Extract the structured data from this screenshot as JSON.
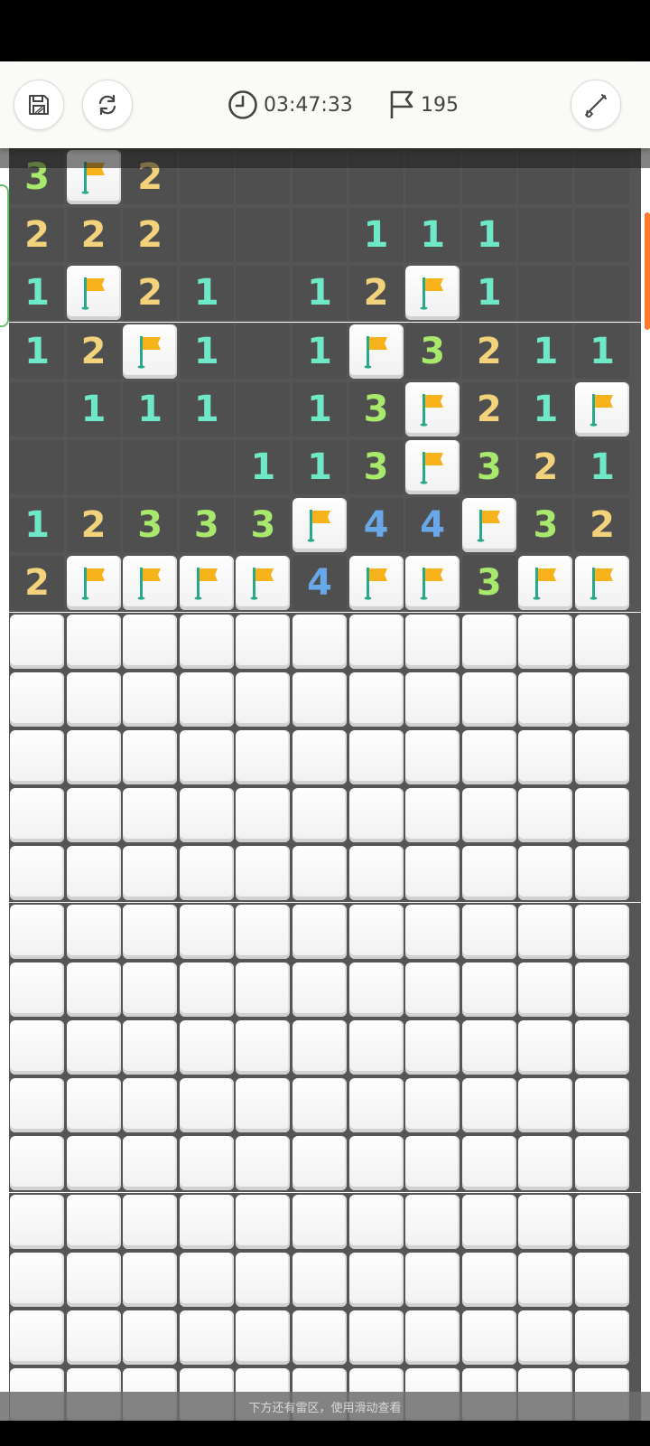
{
  "toolbar": {
    "save_icon": "floppy-disk-icon",
    "restart_icon": "refresh-icon",
    "timer_icon": "clock-icon",
    "timer": "03:47:33",
    "flag_icon": "flag-outline-icon",
    "flags_remaining": "195",
    "tool_icon": "shovel-icon"
  },
  "colors": {
    "n1": "#6fe8c8",
    "n2": "#f2d27a",
    "n3": "#a8e86c",
    "n4": "#69a8e8",
    "flag": "#f7b21c",
    "scroll_accent": "#ff7a2a"
  },
  "board": {
    "rows": [
      [
        "3",
        "F",
        "2",
        "O",
        "O",
        "O",
        "O",
        "O",
        "O",
        "O",
        "O"
      ],
      [
        "2",
        "2",
        "2",
        "O",
        "O",
        "O",
        "1",
        "1",
        "1",
        "O",
        "O"
      ],
      [
        "1",
        "F",
        "2",
        "1",
        "O",
        "1",
        "2",
        "F",
        "1",
        "O",
        "O"
      ],
      [
        "1",
        "2",
        "F",
        "1",
        "O",
        "1",
        "F",
        "3",
        "2",
        "1",
        "1"
      ],
      [
        "O",
        "1",
        "1",
        "1",
        "O",
        "1",
        "3",
        "F",
        "2",
        "1",
        "F"
      ],
      [
        "O",
        "O",
        "O",
        "O",
        "1",
        "1",
        "3",
        "F",
        "3",
        "2",
        "1"
      ],
      [
        "1",
        "2",
        "3",
        "3",
        "3",
        "F",
        "4",
        "4",
        "F",
        "3",
        "2"
      ],
      [
        "2",
        "F",
        "F",
        "F",
        "F",
        "4",
        "F",
        "F",
        "3",
        "F",
        "F"
      ],
      [
        "H",
        "H",
        "H",
        "H",
        "H",
        "H",
        "H",
        "H",
        "H",
        "H",
        "H"
      ],
      [
        "H",
        "H",
        "H",
        "H",
        "H",
        "H",
        "H",
        "H",
        "H",
        "H",
        "H"
      ],
      [
        "H",
        "H",
        "H",
        "H",
        "H",
        "H",
        "H",
        "H",
        "H",
        "H",
        "H"
      ],
      [
        "H",
        "H",
        "H",
        "H",
        "H",
        "H",
        "H",
        "H",
        "H",
        "H",
        "H"
      ],
      [
        "H",
        "H",
        "H",
        "H",
        "H",
        "H",
        "H",
        "H",
        "H",
        "H",
        "H"
      ],
      [
        "H",
        "H",
        "H",
        "H",
        "H",
        "H",
        "H",
        "H",
        "H",
        "H",
        "H"
      ],
      [
        "H",
        "H",
        "H",
        "H",
        "H",
        "H",
        "H",
        "H",
        "H",
        "H",
        "H"
      ],
      [
        "H",
        "H",
        "H",
        "H",
        "H",
        "H",
        "H",
        "H",
        "H",
        "H",
        "H"
      ],
      [
        "H",
        "H",
        "H",
        "H",
        "H",
        "H",
        "H",
        "H",
        "H",
        "H",
        "H"
      ],
      [
        "H",
        "H",
        "H",
        "H",
        "H",
        "H",
        "H",
        "H",
        "H",
        "H",
        "H"
      ],
      [
        "H",
        "H",
        "H",
        "H",
        "H",
        "H",
        "H",
        "H",
        "H",
        "H",
        "H"
      ],
      [
        "H",
        "H",
        "H",
        "H",
        "H",
        "H",
        "H",
        "H",
        "H",
        "H",
        "H"
      ],
      [
        "H",
        "H",
        "H",
        "H",
        "H",
        "H",
        "H",
        "H",
        "H",
        "H",
        "H"
      ],
      [
        "H",
        "H",
        "H",
        "H",
        "H",
        "H",
        "H",
        "H",
        "H",
        "H",
        "H"
      ],
      [
        "H",
        "H",
        "H",
        "H",
        "H",
        "H",
        "H",
        "H",
        "H",
        "H",
        "H"
      ]
    ]
  },
  "hint": "下方还有雷区，使用滑动查看"
}
